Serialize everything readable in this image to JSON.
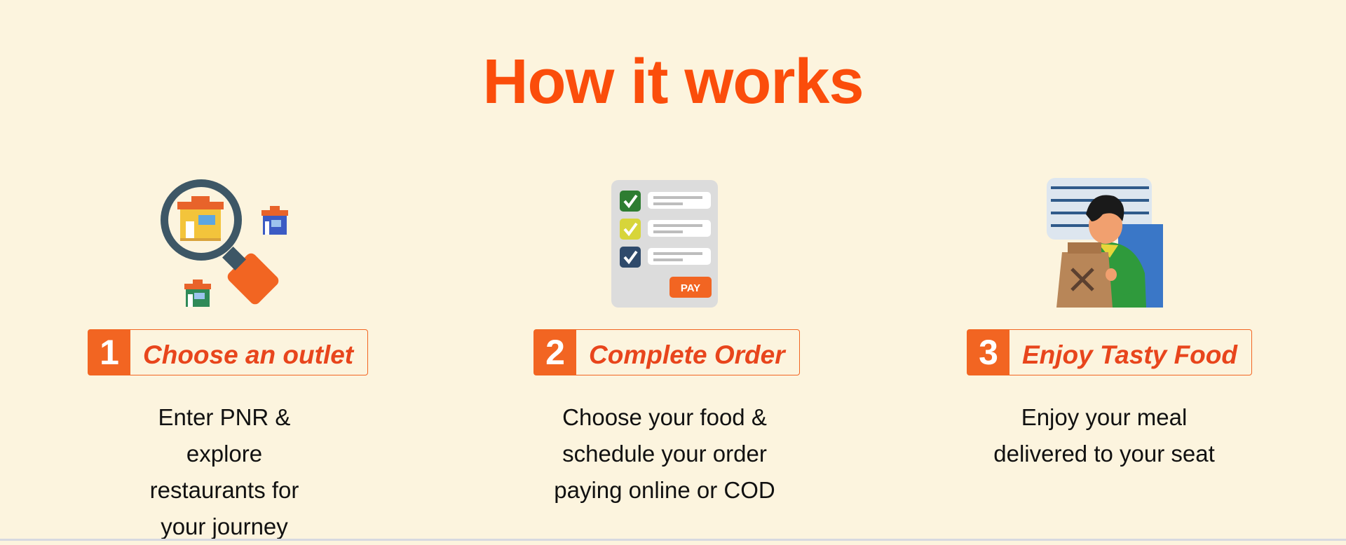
{
  "section": {
    "title": "How it works"
  },
  "steps": [
    {
      "number": "1",
      "label": "Choose an outlet",
      "description": "Enter PNR & explore restaurants for your journey",
      "icon": "magnifier-outlet-icon"
    },
    {
      "number": "2",
      "label": "Complete Order",
      "description": "Choose your food & schedule your order paying online or COD",
      "icon": "checklist-pay-icon",
      "pay_text": "PAY"
    },
    {
      "number": "3",
      "label": "Enjoy Tasty Food",
      "description": "Enjoy your meal delivered to your seat",
      "icon": "delivery-person-icon"
    }
  ],
  "colors": {
    "accent": "#f26522",
    "title": "#fb4d0b",
    "background": "#fcf4de"
  }
}
